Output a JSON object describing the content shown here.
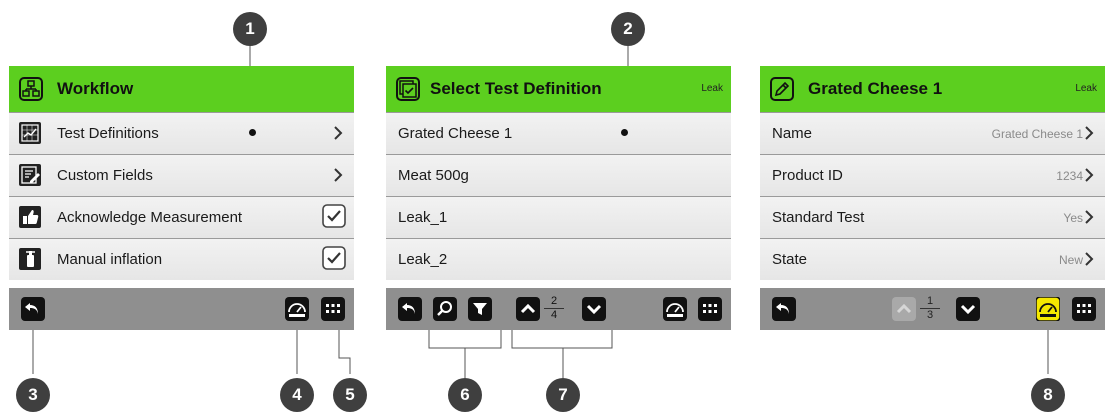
{
  "panels": [
    {
      "title": "Workflow",
      "rows": [
        {
          "label": "Test Definitions"
        },
        {
          "label": "Custom Fields"
        },
        {
          "label": "Acknowledge Measurement"
        },
        {
          "label": "Manual inflation"
        }
      ]
    },
    {
      "title": "Select Test Definition",
      "tag": "Leak",
      "rows": [
        {
          "label": "Grated Cheese 1"
        },
        {
          "label": "Meat 500g"
        },
        {
          "label": "Leak_1"
        },
        {
          "label": "Leak_2"
        }
      ],
      "page_current": "2",
      "page_total": "4"
    },
    {
      "title": "Grated Cheese 1",
      "tag": "Leak",
      "rows": [
        {
          "label": "Name",
          "value": "Grated Cheese 1"
        },
        {
          "label": "Product ID",
          "value": "1234"
        },
        {
          "label": "Standard Test",
          "value": "Yes"
        },
        {
          "label": "State",
          "value": "New"
        }
      ],
      "page_current": "1",
      "page_total": "3"
    }
  ],
  "callouts": [
    "1",
    "2",
    "3",
    "4",
    "5",
    "6",
    "7",
    "8"
  ],
  "colors": {
    "header": "#5ccf1f",
    "footer": "#8f8f8f",
    "highlight": "#f5e800",
    "callout": "#3f3f3f"
  }
}
